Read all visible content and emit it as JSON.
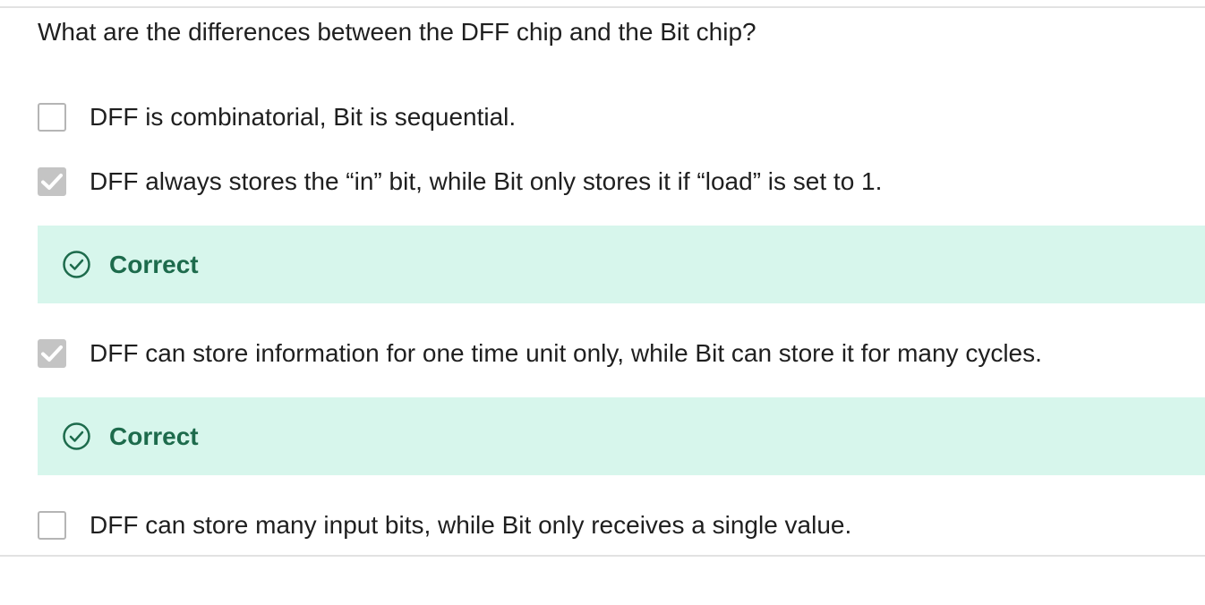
{
  "question": {
    "text": "What are the differences between the DFF chip and the Bit chip?"
  },
  "options": [
    {
      "label": "DFF is combinatorial, Bit is sequential.",
      "checked": false
    },
    {
      "label": "DFF always stores the “in” bit, while Bit only stores it if “load” is set to 1.",
      "checked": true
    },
    {
      "label": "DFF can store information for one time unit only, while Bit can store it for many cycles.",
      "checked": true
    },
    {
      "label": "DFF can store many input bits, while Bit only receives a single value.",
      "checked": false
    }
  ],
  "feedback": [
    {
      "label": "Correct",
      "icon": "check-circle-icon"
    },
    {
      "label": "Correct",
      "icon": "check-circle-icon"
    }
  ],
  "colors": {
    "feedback_background": "#d7f6ec",
    "feedback_text": "#1d6b4c",
    "checkbox_checked": "#c4c4c4",
    "checkbox_border": "#b5b5b5"
  }
}
